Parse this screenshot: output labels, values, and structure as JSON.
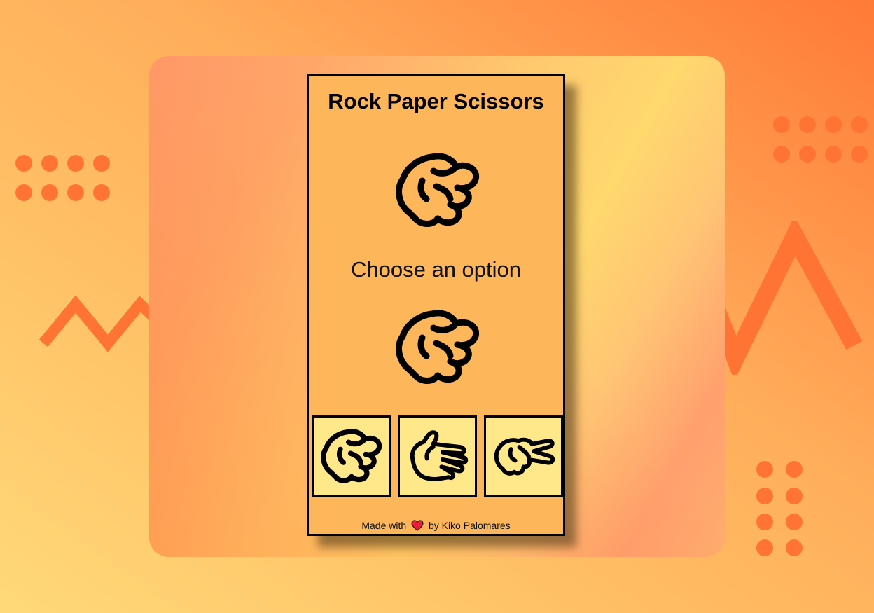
{
  "app": {
    "title": "Rock Paper Scissors",
    "status_text": "Choose an option"
  },
  "hands": {
    "player_choice": "rock-icon",
    "computer_choice": "rock-icon"
  },
  "options": [
    {
      "name": "rock",
      "icon": "rock-icon"
    },
    {
      "name": "paper",
      "icon": "paper-icon"
    },
    {
      "name": "scissors",
      "icon": "scissors-icon"
    }
  ],
  "footer": {
    "made_with": "Made with",
    "by_text": "by Kiko Palomares"
  },
  "colors": {
    "card_bg": "#fdb65a",
    "option_bg": "#ffe88a",
    "accent": "#ff7433",
    "heart": "#e8203a"
  }
}
